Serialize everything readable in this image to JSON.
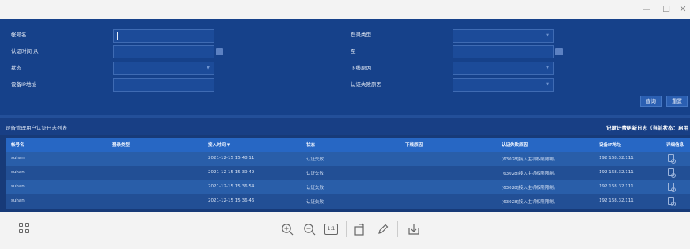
{
  "window": {
    "minimize_glyph": "—",
    "maximize_glyph": "☐",
    "close_glyph": "✕"
  },
  "form": {
    "account_label": "帐号名",
    "auth_time_label": "认证时间 从",
    "status_label": "状态",
    "device_ip_label": "设备IP地址",
    "login_type_label": "登录类型",
    "to_label": "至",
    "offline_reason_label": "下线原因",
    "auth_fail_reason_label": "认证失败原因",
    "search_button": "查询",
    "reset_button": "重置"
  },
  "list": {
    "title": "设备管理用户认证日志列表",
    "right_text": "记录计费更新日志（当前状态：启用"
  },
  "table": {
    "columns": [
      "帐号名",
      "登录类型",
      "接入时间 ▼",
      "状态",
      "下线原因",
      "认证失败原因",
      "设备IP地址",
      "详细信息"
    ],
    "rows": [
      {
        "account": "suhan",
        "login_type": "",
        "time": "2021-12-15 15:48:11",
        "status": "认证失败",
        "offline_reason": "",
        "fail_reason": "[63028]接入主机权限限制。",
        "ip": "192.168.32.111"
      },
      {
        "account": "suhan",
        "login_type": "",
        "time": "2021-12-15 15:39:49",
        "status": "认证失败",
        "offline_reason": "",
        "fail_reason": "[63028]接入主机权限限制。",
        "ip": "192.168.32.111"
      },
      {
        "account": "suhan",
        "login_type": "",
        "time": "2021-12-15 15:36:54",
        "status": "认证失败",
        "offline_reason": "",
        "fail_reason": "[63028]接入主机权限限制。",
        "ip": "192.168.32.111"
      },
      {
        "account": "suhan",
        "login_type": "",
        "time": "2021-12-15 15:36:46",
        "status": "认证失败",
        "offline_reason": "",
        "fail_reason": "[63028]接入主机权限限制。",
        "ip": "192.168.32.111"
      }
    ]
  },
  "toolbar": {
    "zoom_in_glyph": "⊕",
    "zoom_out_glyph": "⊖",
    "actual_size_label": "1:1",
    "icons": [
      "grid-icon",
      "zoom-in-icon",
      "zoom-out-icon",
      "actual-size-icon",
      "rotate-icon",
      "edit-icon",
      "download-icon"
    ]
  },
  "colors": {
    "panel_blue": "#16418a",
    "header_row_blue": "#2767c4",
    "row_light": "#295ea9",
    "row_dark": "#224f95"
  }
}
